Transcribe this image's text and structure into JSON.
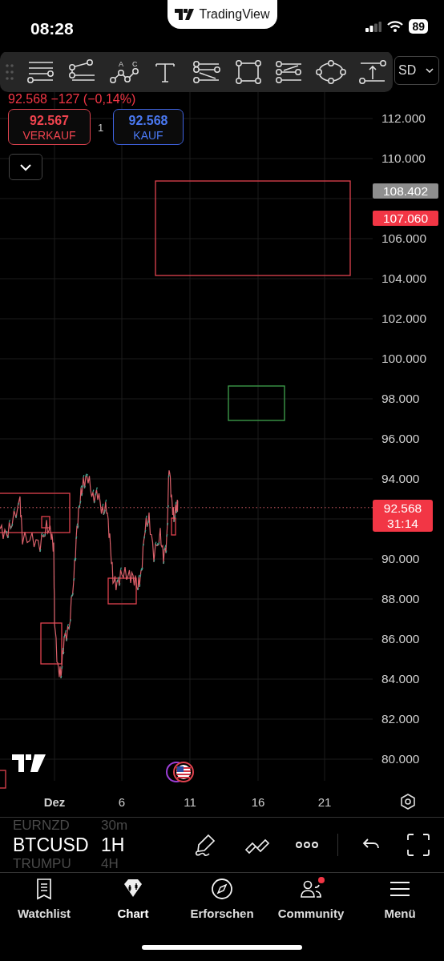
{
  "status_bar": {
    "time": "08:28",
    "battery": "89",
    "app_pill": "TradingView"
  },
  "symbol_selector": {
    "label": "SD"
  },
  "quote": {
    "price_line": "92.568 −127 (−0,14%)",
    "sell": {
      "price": "92.567",
      "label": "VERKAUF"
    },
    "quantity": "1",
    "buy": {
      "price": "92.568",
      "label": "KAUF"
    }
  },
  "pattern_tool_labels": [
    "A",
    "C"
  ],
  "price_axis": [
    "112.000",
    "110.000",
    "106.000",
    "104.000",
    "102.000",
    "100.000",
    "98.000",
    "96.000",
    "94.000",
    "90.000",
    "88.000",
    "86.000",
    "84.000",
    "82.000",
    "80.000"
  ],
  "price_badges": [
    {
      "kind": "line",
      "text": "108.402",
      "color": "#8e8e8e"
    },
    {
      "kind": "line",
      "text": "107.060",
      "color": "#f23645"
    },
    {
      "kind": "last",
      "text": "92.568",
      "countdown": "31:14",
      "color": "#f23645"
    }
  ],
  "time_axis": [
    {
      "label": "Dez",
      "bold": true
    },
    {
      "label": "6",
      "bold": false
    },
    {
      "label": "11",
      "bold": false
    },
    {
      "label": "16",
      "bold": false
    },
    {
      "label": "21",
      "bold": false
    }
  ],
  "picker": [
    {
      "symbol": "EURNZD",
      "interval": "30m",
      "selected": false
    },
    {
      "symbol": "BTCUSD",
      "interval": "1H",
      "selected": true
    },
    {
      "symbol": "TRUMPU",
      "interval": "4H",
      "selected": false
    }
  ],
  "tabs": [
    {
      "label": "Watchlist",
      "kind": "watchlist",
      "selected": false,
      "badge": false
    },
    {
      "label": "Chart",
      "kind": "chart",
      "selected": true,
      "badge": false
    },
    {
      "label": "Erforschen",
      "kind": "explore",
      "selected": false,
      "badge": false
    },
    {
      "label": "Community",
      "kind": "community",
      "selected": false,
      "badge": true
    },
    {
      "label": "Menü",
      "kind": "menu",
      "selected": false,
      "badge": false
    }
  ]
}
